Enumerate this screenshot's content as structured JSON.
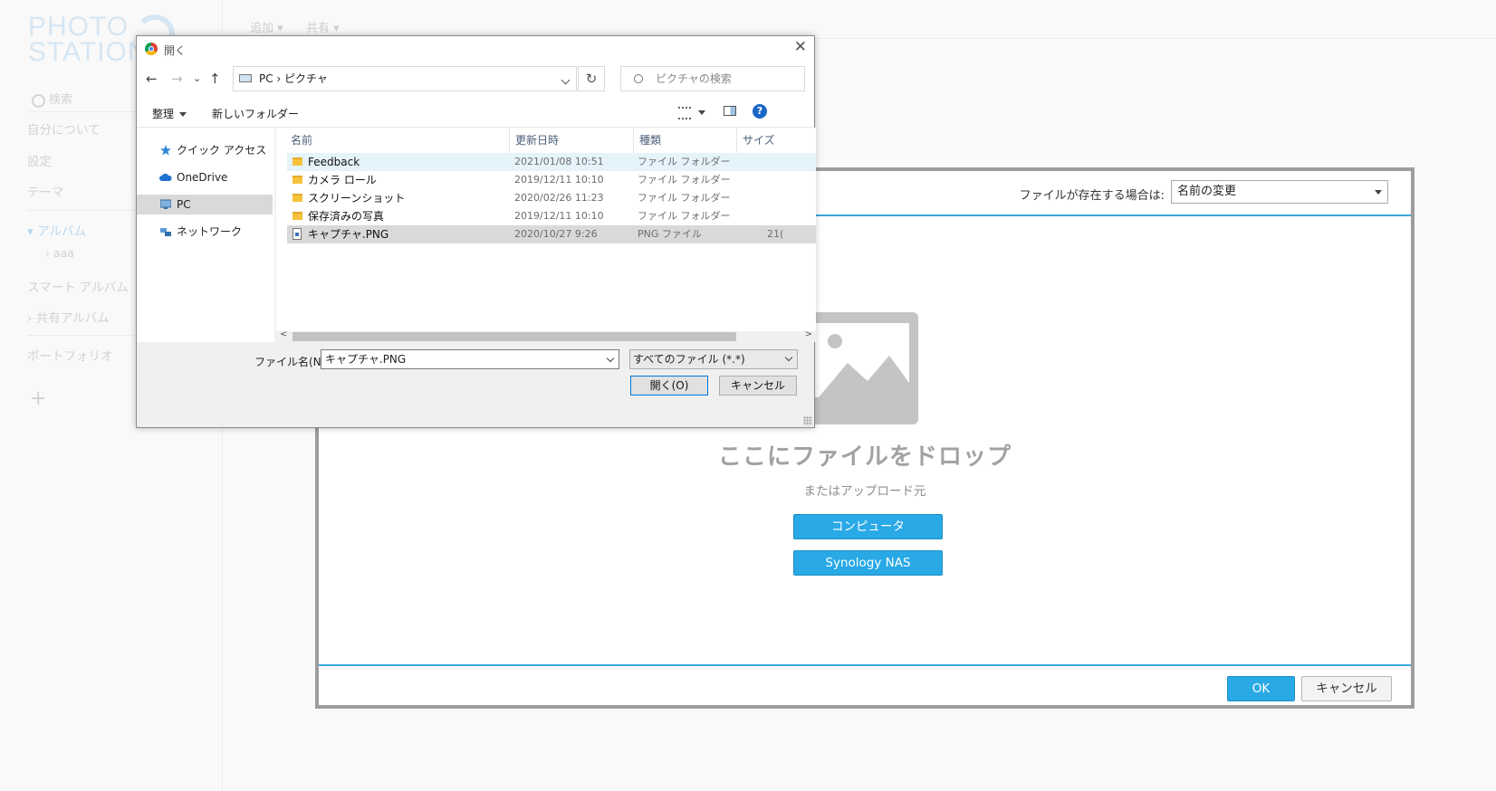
{
  "background": {
    "logo_line1": "PHOTO",
    "logo_line2": "STATION",
    "search_placeholder": "検索",
    "nav": {
      "about": "自分について",
      "settings": "設定",
      "theme": "テーマ",
      "album": "アルバム",
      "album_child": "aaa",
      "smart_album": "スマート アルバム",
      "shared_album": "共有アルバム",
      "portfolio": "ポートフォリオ",
      "add": "+"
    },
    "topbar": {
      "add_menu": "追加 ▾",
      "share_menu": "共有 ▾"
    }
  },
  "upload_panel": {
    "conflict_label": "ファイルが存在する場合は:",
    "conflict_value": "名前の変更",
    "drop_title": "ここにファイルをドロップ",
    "drop_subtitle": "またはアップロード元",
    "computer_button": "コンピュータ",
    "nas_button": "Synology NAS",
    "ok_button": "OK",
    "cancel_button": "キャンセル"
  },
  "dialog": {
    "title": "開く",
    "close": "✕",
    "nav": {
      "back": "←",
      "forward": "→",
      "recent": "⌄",
      "up": "↑",
      "refresh": "↻"
    },
    "address": "PC  ›  ピクチャ",
    "search_placeholder": "ピクチャの検索",
    "organize": "整理",
    "new_folder": "新しいフォルダー",
    "help": "?",
    "sidebar": [
      {
        "label": "クイック アクセス",
        "icon": "star-icon"
      },
      {
        "label": "OneDrive",
        "icon": "cloud-icon"
      },
      {
        "label": "PC",
        "icon": "pc-icon"
      },
      {
        "label": "ネットワーク",
        "icon": "network-icon"
      }
    ],
    "columns": {
      "name": "名前",
      "date": "更新日時",
      "type": "種類",
      "size": "サイズ"
    },
    "files": [
      {
        "name": "Feedback",
        "date": "2021/01/08 10:51",
        "type": "ファイル フォルダー",
        "size": ""
      },
      {
        "name": "カメラ ロール",
        "date": "2019/12/11 10:10",
        "type": "ファイル フォルダー",
        "size": ""
      },
      {
        "name": "スクリーンショット",
        "date": "2020/02/26 11:23",
        "type": "ファイル フォルダー",
        "size": ""
      },
      {
        "name": "保存済みの写真",
        "date": "2019/12/11 10:10",
        "type": "ファイル フォルダー",
        "size": ""
      },
      {
        "name": "キャプチャ.PNG",
        "date": "2020/10/27 9:26",
        "type": "PNG ファイル",
        "size": "21("
      }
    ],
    "filename_label": "ファイル名(N):",
    "filename_value": "キャプチャ.PNG",
    "filetype_value": "すべてのファイル (*.*)",
    "open_button": "開く(O)",
    "cancel_button": "キャンセル"
  },
  "colors": {
    "accent": "#29a9e6",
    "panel_border": "#9d9d9d",
    "selection": "#d9d9d9",
    "hover": "#e5f3fb"
  }
}
